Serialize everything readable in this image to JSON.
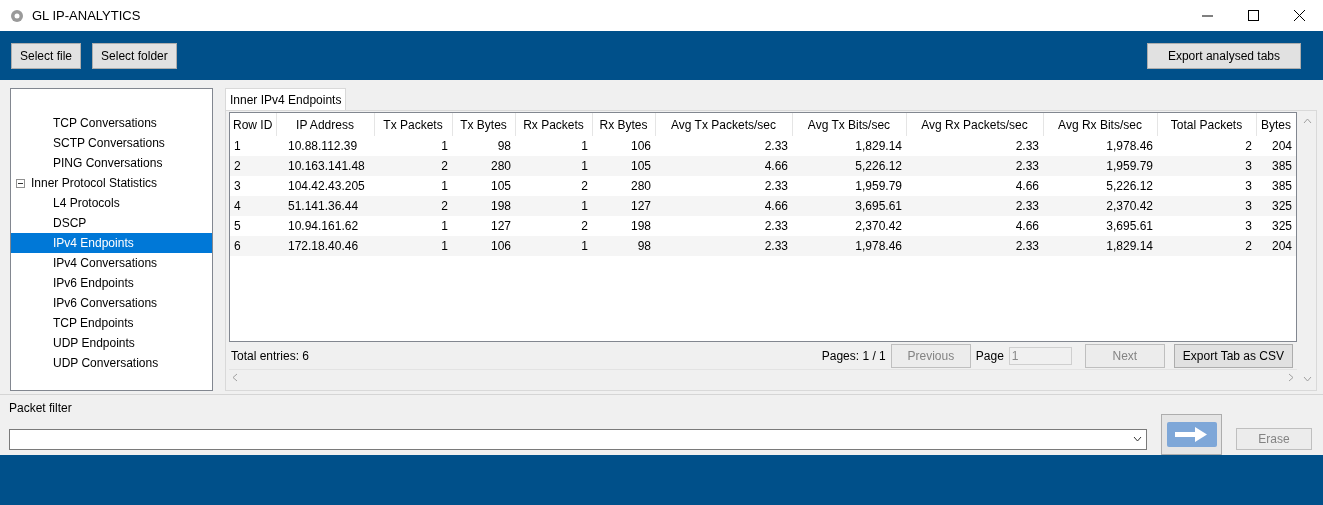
{
  "window": {
    "title": "GL IP-ANALYTICS"
  },
  "toolbar": {
    "left_buttons": [
      "Select file",
      "Select folder"
    ],
    "right_button": "Export analysed tabs"
  },
  "tree": [
    {
      "label": "TCP Conversations",
      "selected": false
    },
    {
      "label": "SCTP Conversations",
      "selected": false
    },
    {
      "label": "PING Conversations",
      "selected": false
    },
    {
      "label": "Inner Protocol Statistics",
      "selected": false,
      "expanded": true,
      "children": [
        {
          "label": "L4 Protocols",
          "selected": false
        },
        {
          "label": "DSCP",
          "selected": false
        },
        {
          "label": "IPv4 Endpoints",
          "selected": true
        },
        {
          "label": "IPv4 Conversations",
          "selected": false
        },
        {
          "label": "IPv6 Endpoints",
          "selected": false
        },
        {
          "label": "IPv6 Conversations",
          "selected": false
        },
        {
          "label": "TCP Endpoints",
          "selected": false
        },
        {
          "label": "UDP Endpoints",
          "selected": false
        },
        {
          "label": "UDP Conversations",
          "selected": false
        }
      ]
    }
  ],
  "tabs": [
    {
      "label": "Inner IPv4 Endpoints",
      "selected": true
    }
  ],
  "table": {
    "columns": [
      "Row ID",
      "IP Address",
      "Tx Packets",
      "Tx Bytes",
      "Rx Packets",
      "Rx Bytes",
      "Avg Tx Packets/sec",
      "Avg Tx Bits/sec",
      "Avg Rx Packets/sec",
      "Avg Rx Bits/sec",
      "Total Packets",
      "Bytes"
    ],
    "rows": [
      [
        "1",
        "10.88.112.39",
        "1",
        "98",
        "1",
        "106",
        "2.33",
        "1,829.14",
        "2.33",
        "1,978.46",
        "2",
        "204"
      ],
      [
        "2",
        "10.163.141.48",
        "2",
        "280",
        "1",
        "105",
        "4.66",
        "5,226.12",
        "2.33",
        "1,959.79",
        "3",
        "385"
      ],
      [
        "3",
        "104.42.43.205",
        "1",
        "105",
        "2",
        "280",
        "2.33",
        "1,959.79",
        "4.66",
        "5,226.12",
        "3",
        "385"
      ],
      [
        "4",
        "51.141.36.44",
        "2",
        "198",
        "1",
        "127",
        "4.66",
        "3,695.61",
        "2.33",
        "2,370.42",
        "3",
        "325"
      ],
      [
        "5",
        "10.94.161.62",
        "1",
        "127",
        "2",
        "198",
        "2.33",
        "2,370.42",
        "4.66",
        "3,695.61",
        "3",
        "325"
      ],
      [
        "6",
        "172.18.40.46",
        "1",
        "106",
        "1",
        "98",
        "2.33",
        "1,978.46",
        "2.33",
        "1,829.14",
        "2",
        "204"
      ]
    ]
  },
  "footer": {
    "total": "Total entries: 6",
    "pages": "Pages: 1 / 1",
    "previous": {
      "label": "Previous",
      "disabled": true
    },
    "page_label": "Page",
    "page_field": {
      "value": "1",
      "disabled": true
    },
    "next": {
      "label": "Next",
      "disabled": true
    },
    "export": "Export Tab as CSV"
  },
  "packet_filter": {
    "label": "Packet filter",
    "erase": {
      "label": "Erase",
      "disabled": true
    }
  }
}
